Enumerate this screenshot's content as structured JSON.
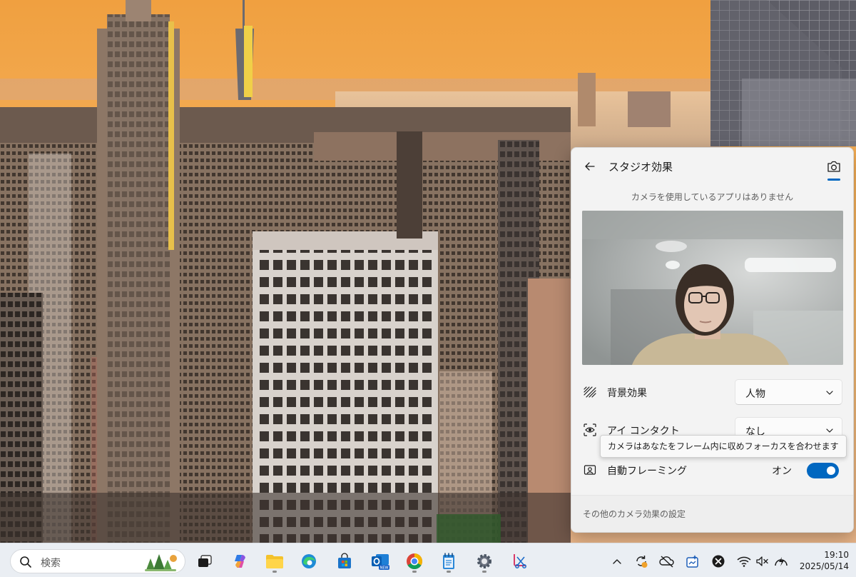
{
  "flyout": {
    "title": "スタジオ効果",
    "status": "カメラを使用しているアプリはありません",
    "rows": {
      "background_effect": {
        "label": "背景効果",
        "value": "人物"
      },
      "eye_contact": {
        "label": "アイ コンタクト",
        "value": "なし"
      },
      "auto_framing": {
        "label": "自動フレーミング",
        "state": "オン",
        "on": true
      }
    },
    "tooltip": "カメラはあなたをフレーム内に収めフォーカスを合わせます",
    "footer_link": "その他のカメラ効果の設定",
    "accent_color": "#0067c0"
  },
  "taskbar": {
    "search_placeholder": "検索",
    "apps": [
      "task-view",
      "copilot",
      "file-explorer",
      "edge",
      "store",
      "outlook-new",
      "chrome",
      "notepad",
      "settings",
      "snipping-tool"
    ],
    "tray": [
      "chevron-up",
      "sync-warning",
      "onedrive-offline",
      "screenshot",
      "close-circle",
      "wifi",
      "volume-muted",
      "battery-charging"
    ],
    "time": "19:10",
    "date": "2025/05/14"
  }
}
